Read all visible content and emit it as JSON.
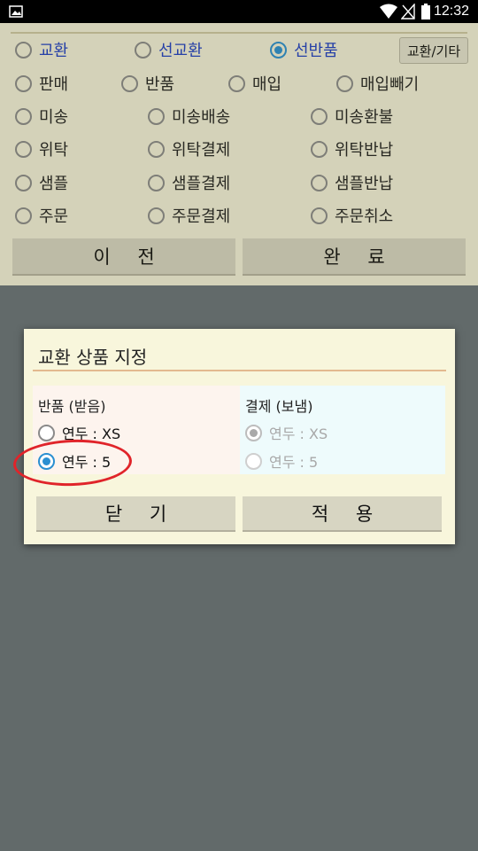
{
  "status_bar": {
    "time": "12:32"
  },
  "screen": {
    "row1": [
      {
        "label": "교환",
        "checked": false,
        "blue": true
      },
      {
        "label": "선교환",
        "checked": false,
        "blue": true
      },
      {
        "label": "선반품",
        "checked": true,
        "blue": true
      }
    ],
    "etc_button": "교환/기타",
    "row2": [
      "판매",
      "반품",
      "매입",
      "매입빼기"
    ],
    "row3": [
      "미송",
      "미송배송",
      "미송환불"
    ],
    "row4": [
      "위탁",
      "위탁결제",
      "위탁반납"
    ],
    "row5": [
      "샘플",
      "샘플결제",
      "샘플반납"
    ],
    "row6": [
      "주문",
      "주문결제",
      "주문취소"
    ],
    "prev_button": "이 전",
    "done_button": "완 료"
  },
  "dialog": {
    "title": "교환 상품 지정",
    "left_column": {
      "title": "반품 (받음)",
      "options": [
        {
          "label": "연두 : XS",
          "checked": false
        },
        {
          "label": "연두 : 5",
          "checked": true
        }
      ]
    },
    "right_column": {
      "title": "결제 (보냄)",
      "options": [
        {
          "label": "연두 : XS",
          "checked": true,
          "disabled": true
        },
        {
          "label": "연두 : 5",
          "checked": false,
          "disabled": true
        }
      ]
    },
    "close_button": "닫 기",
    "apply_button": "적 용"
  },
  "colors": {
    "accent_blue": "#2a8fd1",
    "label_blue": "#1f3fc4",
    "overlay": "#626a6a",
    "annotation_red": "#e0242a"
  }
}
